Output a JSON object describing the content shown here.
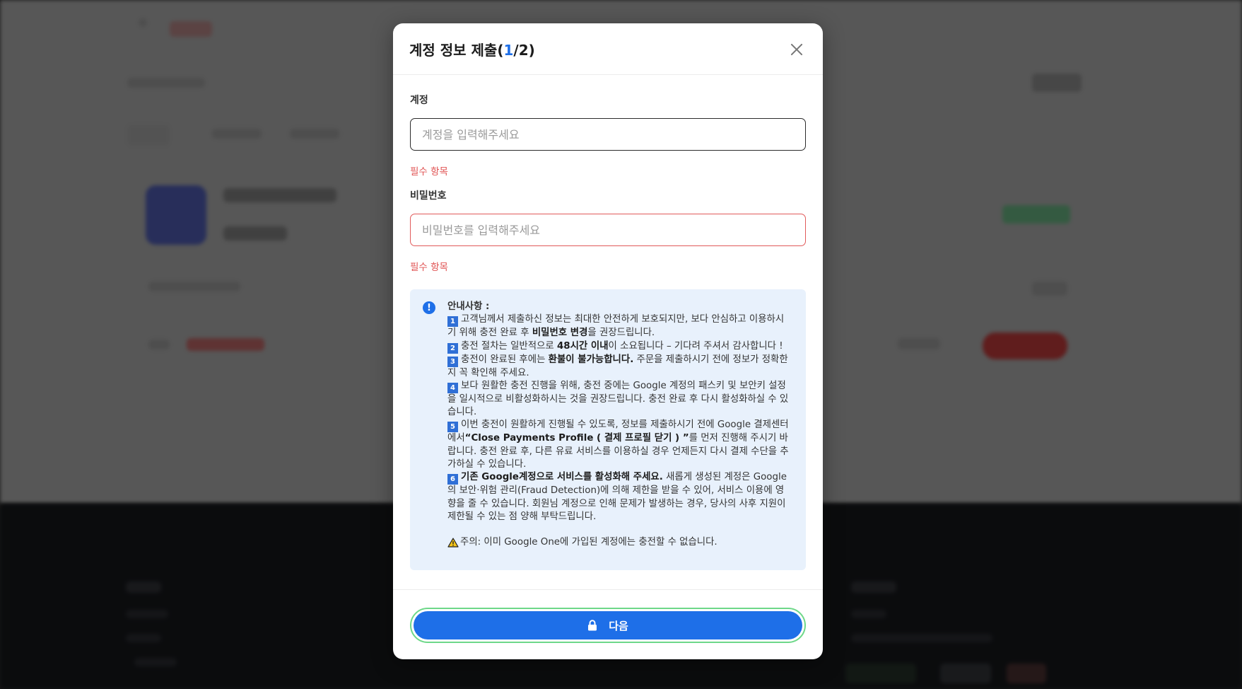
{
  "modal": {
    "title_prefix": "계정 정보 제출(",
    "title_step": "1",
    "title_suffix": "/2)",
    "close_icon": "close-icon"
  },
  "account": {
    "label": "계정",
    "placeholder": "계정을 입력해주세요",
    "value": "",
    "error": "필수 항목"
  },
  "password": {
    "label": "비밀번호",
    "placeholder": "비밀번호를 입력해주세요",
    "value": "",
    "error": "필수 항목"
  },
  "notice": {
    "icon": "info-icon",
    "title": "안내사항 :",
    "items": [
      {
        "num": "1",
        "pre": "고객님께서 제출하신 정보는 최대한 안전하게 보호되지만, 보다 안심하고 이용하시기 위해 충전 완료 후 ",
        "bold": "비밀번호 변경",
        "post": "을 권장드립니다."
      },
      {
        "num": "2",
        "pre": "충전 절차는 일반적으로 ",
        "bold": "48시간 이내",
        "post": "이 소요됩니다 – 기다려 주셔서 감사합니다 !"
      },
      {
        "num": "3",
        "pre": "충전이 완료된 후에는 ",
        "bold": "환불이 불가능합니다.",
        "post": " 주문을 제출하시기 전에 정보가 정확한지 꼭 확인해 주세요."
      },
      {
        "num": "4",
        "pre": "보다 원활한 충전 진행을 위해, 충전 중에는 Google 계정의 패스키 및 보안키 설정을 일시적으로 비활성화하시는 것을 권장드립니다. 충전 완료 후 다시 활성화하실 수 있습니다.",
        "bold": "",
        "post": ""
      },
      {
        "num": "5",
        "pre": "이번 충전이 원활하게 진행될 수 있도록, 정보를 제출하시기 전에 Google 결제센터에서",
        "bold": "“Close Payments Profile ( 결제 프로필 닫기 ) ”",
        "post": "를 먼저 진행해 주시기 바랍니다. 충전 완료 후, 다른 유료 서비스를 이용하실 경우 언제든지 다시 결제 수단을 추가하실 수 있습니다."
      },
      {
        "num": "6",
        "pre": "",
        "bold": "기존 Google계정으로 서비스를 활성화해 주세요.",
        "post": " 새롭게 생성된 계정은 Google의 보안·위험 관리(Fraud Detection)에 의해 제한을 받을 수 있어, 서비스 이용에 영향을 줄 수 있습니다. 회원님 계정으로 인해 문제가 발생하는 경우, 당사의 사후 지원이 제한될 수 있는 점 양해 부탁드립니다."
      }
    ],
    "warning_icon": "warning-icon",
    "warning": "주의: 이미 Google One에 가입된 계정에는 충전할 수 없습니다."
  },
  "next_button": {
    "label": "다음",
    "icon": "lock-icon"
  },
  "colors": {
    "primary": "#1e6fe8",
    "error": "#e05454",
    "notice_bg": "#e8f1fc",
    "button_outline": "#6ed889"
  }
}
